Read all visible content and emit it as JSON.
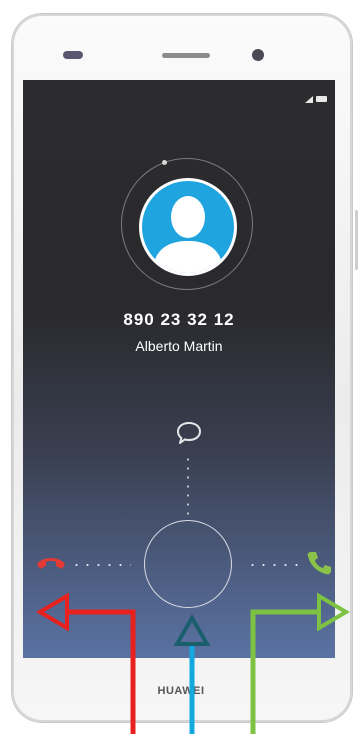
{
  "caller": {
    "number": "890 23 32 12",
    "name": "Alberto Martin"
  },
  "device": {
    "brand": "HUAWEI"
  },
  "icons": {
    "message": "speech-bubble-icon",
    "decline": "phone-hangup-icon",
    "accept": "phone-answer-icon",
    "avatar": "person-silhouette-icon",
    "signal": "signal-icon",
    "battery": "battery-icon"
  },
  "colors": {
    "decline": "#e53935",
    "accept": "#8bc34a",
    "avatar": "#1fa4e0",
    "arrow_red": "#e8211f",
    "arrow_blue": "#14a8e0",
    "arrow_green": "#7dc242",
    "arrow_up_teal": "#1a5f6b"
  }
}
